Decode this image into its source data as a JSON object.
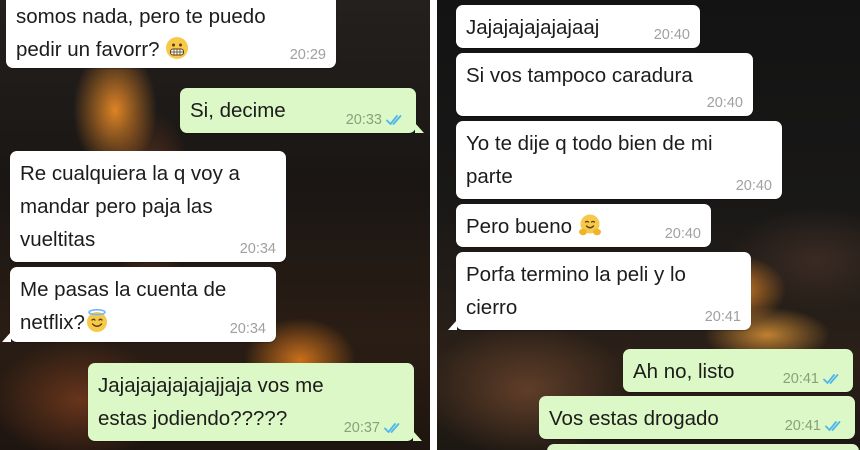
{
  "left_panel": {
    "messages": [
      {
        "dir": "in",
        "text": "somos nada, pero te puedo\npedir un favorr? ",
        "emoji": "grimacing-face",
        "time": "20:29"
      },
      {
        "dir": "out",
        "text": "Si, decime",
        "time": "20:33",
        "read": true
      },
      {
        "dir": "in",
        "text": "Re cualquiera la q voy a\nmandar pero paja las\nvueltitas",
        "time": "20:34"
      },
      {
        "dir": "in",
        "text": "Me pasas la cuenta de\nnetflix?",
        "emoji": "smiling-face-with-halo",
        "time": "20:34"
      },
      {
        "dir": "out",
        "text": "Jajajajajajajajjaja vos me\nestas jodiendo?????",
        "time": "20:37",
        "read": true
      }
    ]
  },
  "right_panel": {
    "messages": [
      {
        "dir": "in",
        "text": "Jajajajajajajaaj",
        "time": "20:40"
      },
      {
        "dir": "in",
        "text": "Si vos tampoco caradura",
        "time": "20:40"
      },
      {
        "dir": "in",
        "text": "Yo te dije q todo bien de mi\nparte",
        "time": "20:40"
      },
      {
        "dir": "in",
        "text": "Pero bueno ",
        "emoji": "hugging-face",
        "time": "20:40"
      },
      {
        "dir": "in",
        "text": "Porfa termino la peli y lo\ncierro",
        "time": "20:41"
      },
      {
        "dir": "out",
        "text": "Ah no, listo",
        "time": "20:41",
        "read": true
      },
      {
        "dir": "out",
        "text": "Vos estas drogado",
        "time": "20:41",
        "read": true
      }
    ]
  },
  "colors": {
    "incoming_bubble": "#ffffff",
    "outgoing_bubble": "#dcf8c6",
    "read_ticks": "#4fb6ec",
    "timestamp": "#a0a0a0"
  }
}
